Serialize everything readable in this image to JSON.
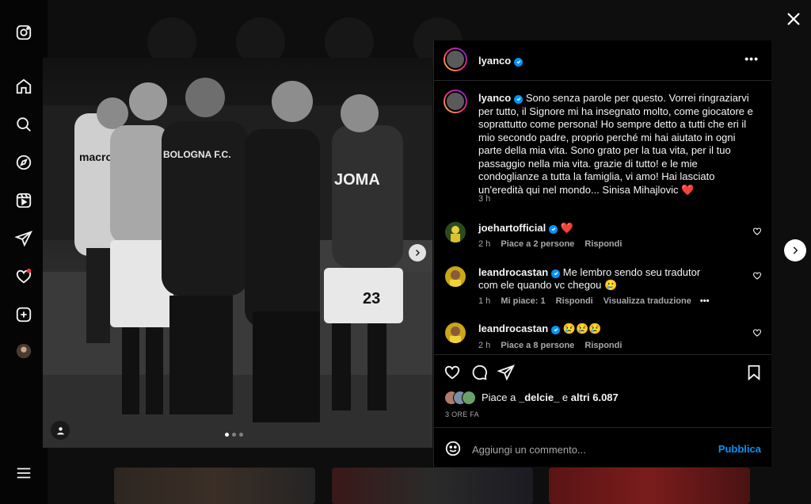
{
  "sidebar": {
    "icons": [
      "instagram-logo-icon",
      "home-icon",
      "search-icon",
      "explore-compass-icon",
      "reels-icon",
      "messages-icon",
      "notifications-heart-icon",
      "create-plus-icon",
      "profile-avatar",
      "menu-icon"
    ]
  },
  "post": {
    "username": "lyanco",
    "more_label": "•••",
    "caption_user": "lyanco",
    "caption_text": "Sono senza parole per questo. Vorrei ringraziarvi per tutto, il Signore mi ha insegnato molto, come giocatore e soprattutto come persona! Ho sempre detto a tutti che eri il mio secondo padre, proprio perché mi hai aiutato in ogni parte della mia vita. Sono grato per la tua vita, per il tuo passaggio nella mia vita. grazie di tutto! e le mie condoglianze a tutta la famiglia, vi amo! Hai lasciato un'eredità qui nel mondo... Sinisa Mihajlovic ❤️",
    "caption_time": "3 h",
    "image_text": {
      "jersey_brand": "macron",
      "jersey_team": "BOLOGNA F.C.",
      "jersey_sponsor": "JOMA",
      "jersey_number": "23"
    }
  },
  "comments": [
    {
      "user": "joehartofficial",
      "text": "❤️",
      "time": "2 h",
      "likes": "Piace a 2 persone",
      "reply": "Rispondi"
    },
    {
      "user": "leandrocastan",
      "text": "Me lembro sendo seu tradutor com ele quando vc chegou 🥲",
      "time": "1 h",
      "likes": "Mi piace: 1",
      "reply": "Rispondi",
      "translate": "Visualizza traduzione",
      "more": "•••"
    },
    {
      "user": "leandrocastan",
      "text": "😢😢😢",
      "time": "2 h",
      "likes": "Piace a 8 persone",
      "reply": "Rispondi"
    }
  ],
  "likes": {
    "prefix": "Piace a ",
    "user": "_delcie_",
    "middle": " e ",
    "others": "altri 6.087"
  },
  "post_time": "3 ORE FA",
  "comment_box": {
    "placeholder": "Aggiungi un commento...",
    "publish": "Pubblica"
  },
  "colors": {
    "accent": "#0095f6",
    "heart": "#ed4956",
    "panel_bg": "#000000"
  }
}
